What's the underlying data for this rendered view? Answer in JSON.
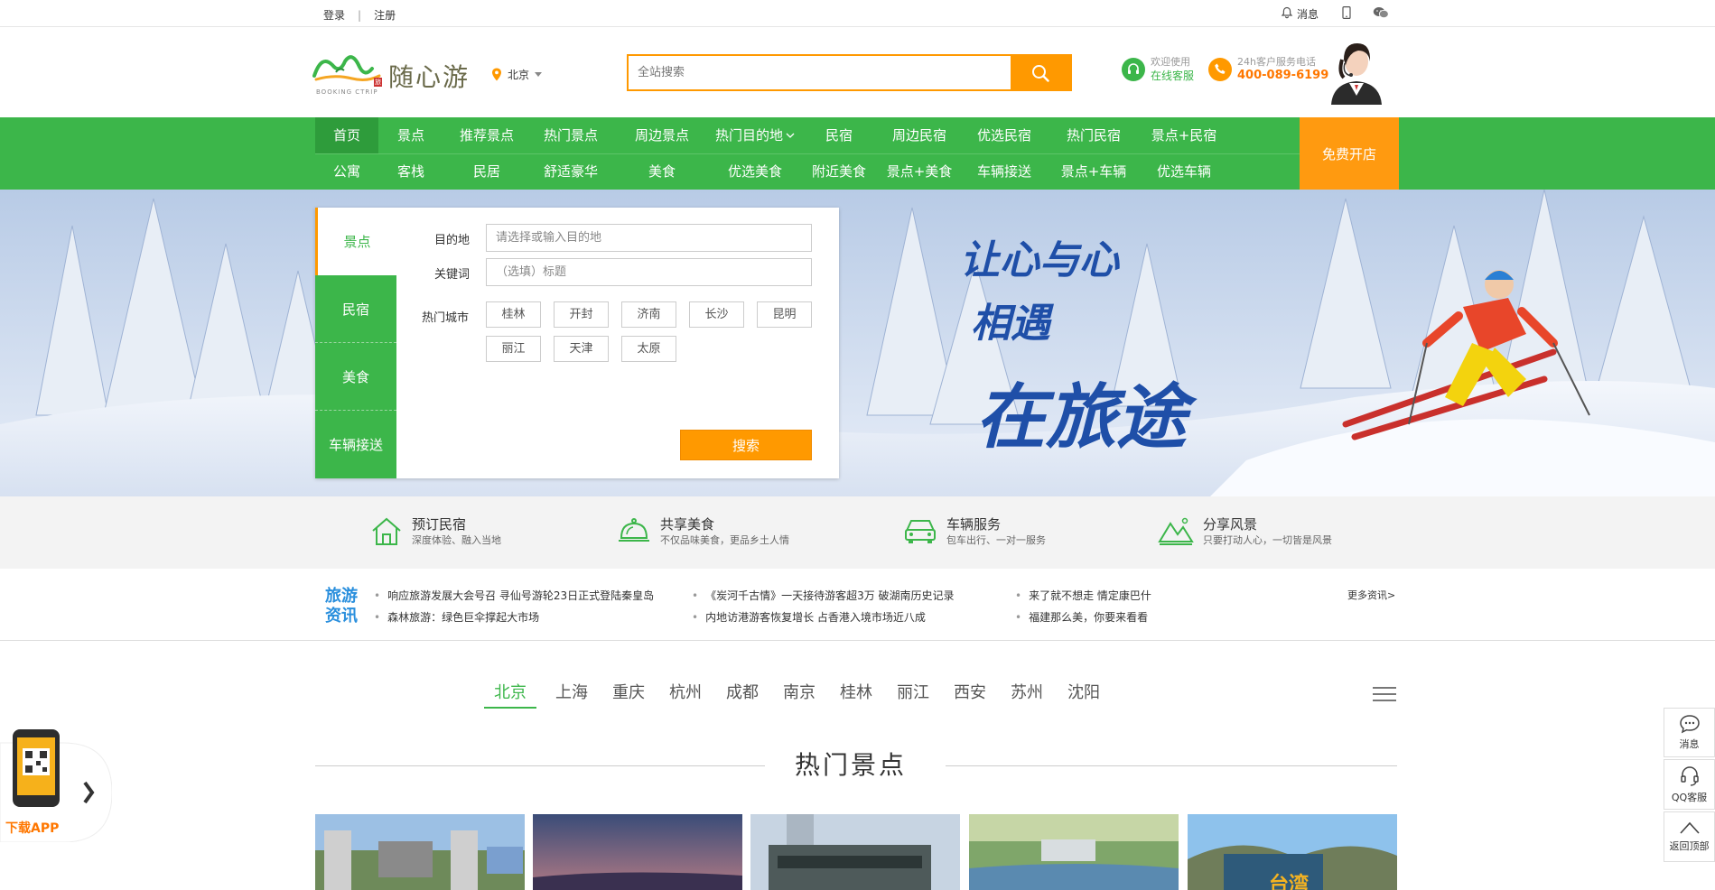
{
  "topbar": {
    "login": "登录",
    "sep": "|",
    "register": "注册",
    "messages": "消息"
  },
  "header": {
    "logo_text": "随心游",
    "logo_badge": "旅",
    "logo_sub": "BOOKING CTRIP",
    "city": "北京",
    "search_placeholder": "全站搜索",
    "service1_line1": "欢迎使用",
    "service1_line2": "在线客服",
    "service2_line1": "24h客户服务电话",
    "service2_line2": "400-089-6199"
  },
  "nav": {
    "row1": [
      "首页",
      "景点",
      "推荐景点",
      "热门景点",
      "周边景点",
      "热门目的地",
      "民宿",
      "周边民宿",
      "优选民宿",
      "热门民宿",
      "景点+民宿"
    ],
    "row2": [
      "公寓",
      "客栈",
      "民居",
      "舒适豪华",
      "美食",
      "优选美食",
      "附近美食",
      "景点+美食",
      "车辆接送",
      "景点+车辆",
      "优选车辆"
    ],
    "open_shop": "免费开店"
  },
  "booking": {
    "tabs": [
      "景点",
      "民宿",
      "美食",
      "车辆接送"
    ],
    "dest_label": "目的地",
    "dest_placeholder": "请选择或输入目的地",
    "kw_label": "关键词",
    "kw_placeholder": "（选填）标题",
    "hot_label": "热门城市",
    "cities": [
      "桂林",
      "开封",
      "济南",
      "长沙",
      "昆明",
      "丽江",
      "天津",
      "太原"
    ],
    "search_button": "搜索"
  },
  "slogan": {
    "line1": "让心与心",
    "line2": "相遇",
    "line3": "在旅途"
  },
  "features": [
    {
      "title": "预订民宿",
      "sub": "深度体验、融入当地"
    },
    {
      "title": "共享美食",
      "sub": "不仅品味美食，更品乡土人情"
    },
    {
      "title": "车辆服务",
      "sub": "包车出行、一对一服务"
    },
    {
      "title": "分享风景",
      "sub": "只要打动人心，一切皆是风景"
    }
  ],
  "news": {
    "tag_line1": "旅游",
    "tag_line2": "资讯",
    "col1": [
      "响应旅游发展大会号召 寻仙号游轮23日正式登陆秦皇岛",
      "森林旅游：绿色巨伞撑起大市场"
    ],
    "col2": [
      "《炭河千古情》一天接待游客超3万 破湖南历史记录",
      "内地访港游客恢复增长 占香港入境市场近八成"
    ],
    "col3": [
      "来了就不想走 情定康巴什",
      "福建那么美，你要来看看"
    ],
    "more": "更多资讯>"
  },
  "city_tabs": [
    "北京",
    "上海",
    "重庆",
    "杭州",
    "成都",
    "南京",
    "桂林",
    "丽江",
    "西安",
    "苏州",
    "沈阳"
  ],
  "hot_title": "热门景点",
  "thumb_text": "台湾",
  "side": {
    "app": "下载APP",
    "msg": "消息",
    "qq": "QQ客服",
    "top": "返回顶部"
  },
  "colors": {
    "green": "#3cb64a",
    "orange": "#ff9900",
    "blue": "#1f4fa8"
  }
}
